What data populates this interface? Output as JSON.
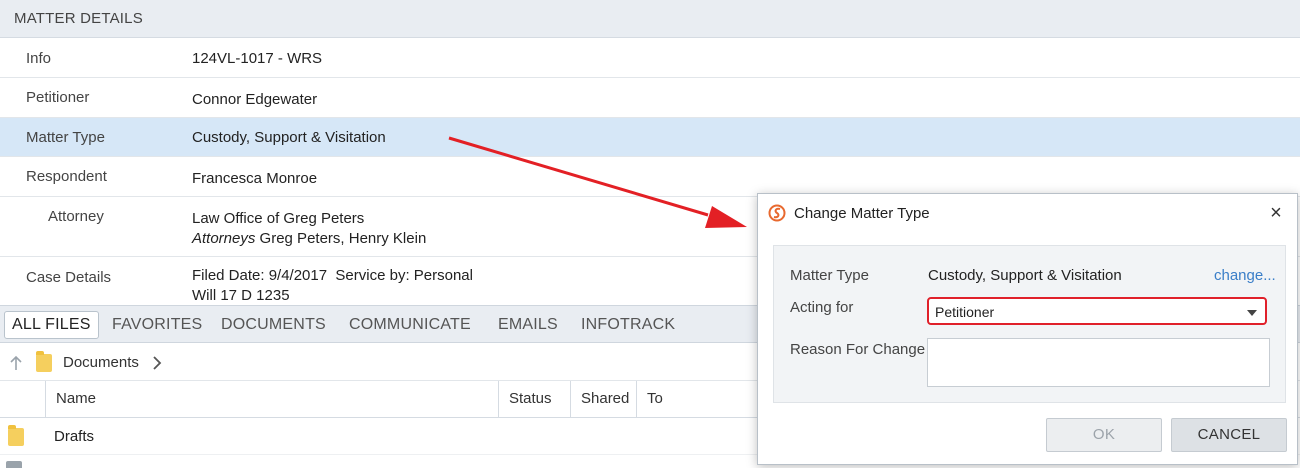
{
  "matter_details": {
    "header": "MATTER DETAILS",
    "rows": [
      {
        "label": "Info",
        "value": "124VL-1017 - WRS"
      },
      {
        "label": "Petitioner",
        "value": "Connor Edgewater"
      },
      {
        "label": "Matter Type",
        "value": "Custody, Support & Visitation"
      },
      {
        "label": "Respondent",
        "value": "Francesca Monroe"
      },
      {
        "label": "Attorney",
        "value": "Law Office of Greg Peters",
        "sub_label": "Attorneys",
        "sub_value": "Greg Peters, Henry Klein"
      },
      {
        "label": "Case Details",
        "value": "Filed Date: 9/4/2017  Service by: Personal",
        "value2": "Will 17 D 1235"
      }
    ]
  },
  "tabs": [
    "ALL FILES",
    "FAVORITES",
    "DOCUMENTS",
    "COMMUNICATE",
    "EMAILS",
    "INFOTRACK"
  ],
  "breadcrumb": {
    "folder": "Documents"
  },
  "table": {
    "columns": [
      "Name",
      "Status",
      "Shared",
      "To"
    ],
    "rows": [
      {
        "name": "Drafts"
      }
    ]
  },
  "dialog": {
    "title": "Change Matter Type",
    "matter_type_label": "Matter Type",
    "matter_type_value": "Custody, Support & Visitation",
    "change_link": "change...",
    "acting_for_label": "Acting for",
    "acting_for_value": "Petitioner",
    "reason_label": "Reason For Change",
    "reason_value": "",
    "ok_label": "OK",
    "cancel_label": "CANCEL",
    "close_symbol": "×"
  },
  "colors": {
    "selected_row": "#d6e7f7",
    "highlight_border": "#e0202a",
    "arrow": "#e32025",
    "link": "#3a7ec8"
  },
  "icons": [
    "back-arrow-icon",
    "folder-icon",
    "chevron-right-icon",
    "app-logo-icon",
    "close-icon",
    "dropdown-caret-icon"
  ]
}
